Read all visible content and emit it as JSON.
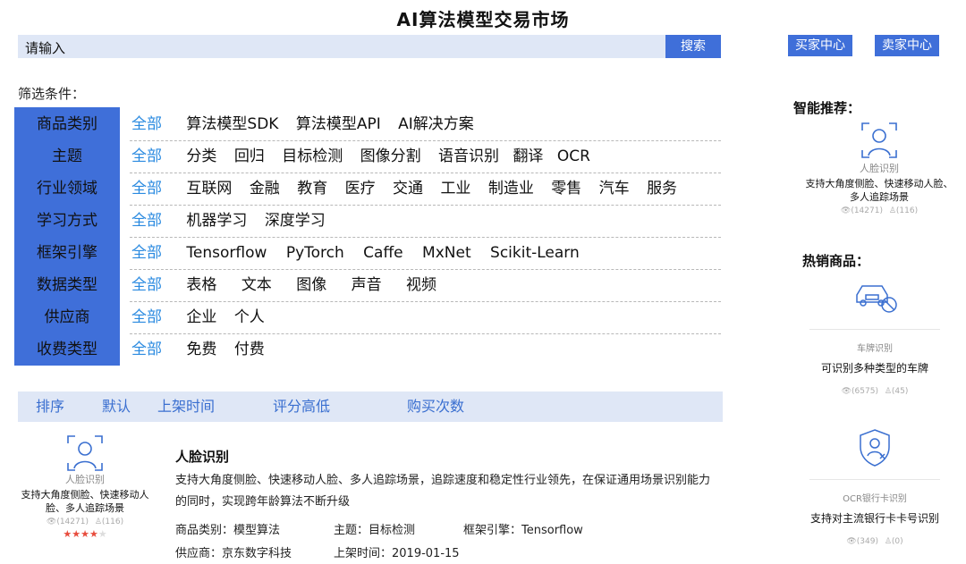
{
  "page": {
    "title": "AI算法模型交易市场"
  },
  "search": {
    "placeholder": "请输入",
    "button": "搜索"
  },
  "header_buttons": {
    "buyer": "买家中心",
    "seller": "卖家中心"
  },
  "filters": {
    "caption": "筛选条件：",
    "all_label": "全部",
    "rows": [
      {
        "category": "商品类别",
        "options": [
          "算法模型SDK",
          "算法模型API",
          "AI解决方案"
        ]
      },
      {
        "category": "主题",
        "options": [
          "分类",
          "回归",
          "目标检测",
          "图像分割",
          "语音识别",
          "翻译",
          "OCR"
        ]
      },
      {
        "category": "行业领域",
        "options": [
          "互联网",
          "金融",
          "教育",
          "医疗",
          "交通",
          "工业",
          "制造业",
          "零售",
          "汽车",
          "服务"
        ]
      },
      {
        "category": "学习方式",
        "options": [
          "机器学习",
          "深度学习"
        ]
      },
      {
        "category": "框架引擎",
        "options": [
          "Tensorflow",
          "PyTorch",
          "Caffe",
          "MxNet",
          "Scikit-Learn"
        ]
      },
      {
        "category": "数据类型",
        "options": [
          "表格",
          "文本",
          "图像",
          "声音",
          "视频"
        ]
      },
      {
        "category": "供应商",
        "options": [
          "企业",
          "个人"
        ]
      },
      {
        "category": "收费类型",
        "options": [
          "免费",
          "付费"
        ]
      }
    ]
  },
  "sort": {
    "label": "排序",
    "options": [
      "默认",
      "上架时间",
      "评分高低",
      "购买次数"
    ]
  },
  "product": {
    "icon_caption": "人脸识别",
    "icon_desc": "支持大角度侧脸、快速移动人脸、多人追踪场景",
    "views": "(14271)",
    "buys": "(116)",
    "rating": 4,
    "title": "人脸识别",
    "description": "支持大角度侧脸、快速移动人脸、多人追踪场景，追踪速度和稳定性行业领先，在保证通用场景识别能力的同时，实现跨年龄算法不断升级",
    "category": "商品类别：模型算法",
    "topic": "主题：目标检测",
    "framework": "框架引擎：Tensorflow",
    "vendor": "供应商：京东数字科技",
    "listed": "上架时间：2019-01-15"
  },
  "sidebar": {
    "recommend_title": "智能推荐：",
    "recommend": {
      "caption": "人脸识别",
      "desc": "支持大角度侧脸、快速移动人脸、多人追踪场景",
      "views": "(14271)",
      "buys": "(116)"
    },
    "hot_title": "热销商品：",
    "hot": [
      {
        "caption": "车牌识别",
        "desc": "可识别多种类型的车牌",
        "views": "(6575)",
        "buys": "(45)"
      },
      {
        "caption": "OCR银行卡识别",
        "desc": "支持对主流银行卡卡号识别",
        "views": "(349)",
        "buys": "(0)"
      }
    ]
  },
  "colors": {
    "accent": "#3f6fd9",
    "link": "#2a8ae0",
    "bar_bg": "#dfe7f6",
    "star": "#e84c3d"
  },
  "icons": [
    "face-scan-icon",
    "car-plate-icon",
    "bank-card-shield-icon",
    "eye-icon",
    "user-icon",
    "star-icon"
  ]
}
